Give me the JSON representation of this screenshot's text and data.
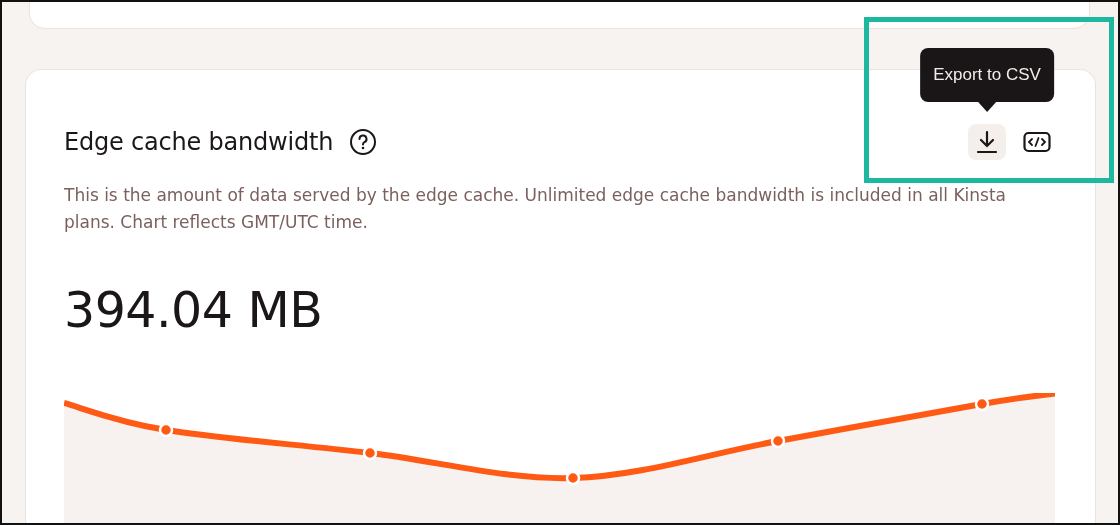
{
  "card": {
    "title": "Edge cache bandwidth",
    "description": "This is the amount of data served by the edge cache. Unlimited edge cache bandwidth is included in all Kinsta plans. Chart reflects GMT/UTC time.",
    "total": "394.04 MB",
    "actions": [
      {
        "kind": "download",
        "hovered": true,
        "tooltip": "Export to CSV"
      },
      {
        "kind": "embed",
        "hovered": false
      }
    ]
  }
}
